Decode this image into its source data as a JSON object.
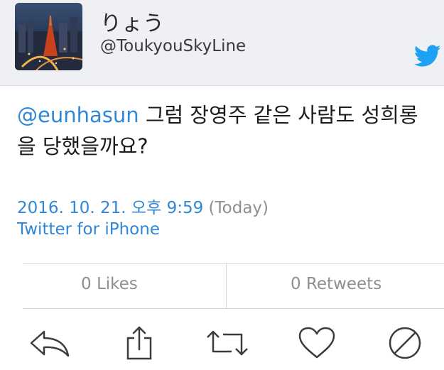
{
  "user": {
    "display_name": "りょう",
    "handle": "@ToukyouSkyLine"
  },
  "tweet": {
    "mention": "@eunhasun",
    "text": " 그럼 장영주 같은 사람도 성희롱을 당했을까요?"
  },
  "meta": {
    "date": "2016. 10. 21. 오후 9:59",
    "relative": " (Today)",
    "client": "Twitter for iPhone"
  },
  "stats": {
    "likes": "0 Likes",
    "retweets": "0 Retweets"
  },
  "actions": [
    "reply-icon",
    "share-icon",
    "retweet-icon",
    "like-icon",
    "block-icon"
  ],
  "colors": {
    "link": "#2f87d6",
    "muted": "#8e8e93",
    "header_bg": "#eff0f3",
    "twitter_blue": "#1da1f2"
  }
}
